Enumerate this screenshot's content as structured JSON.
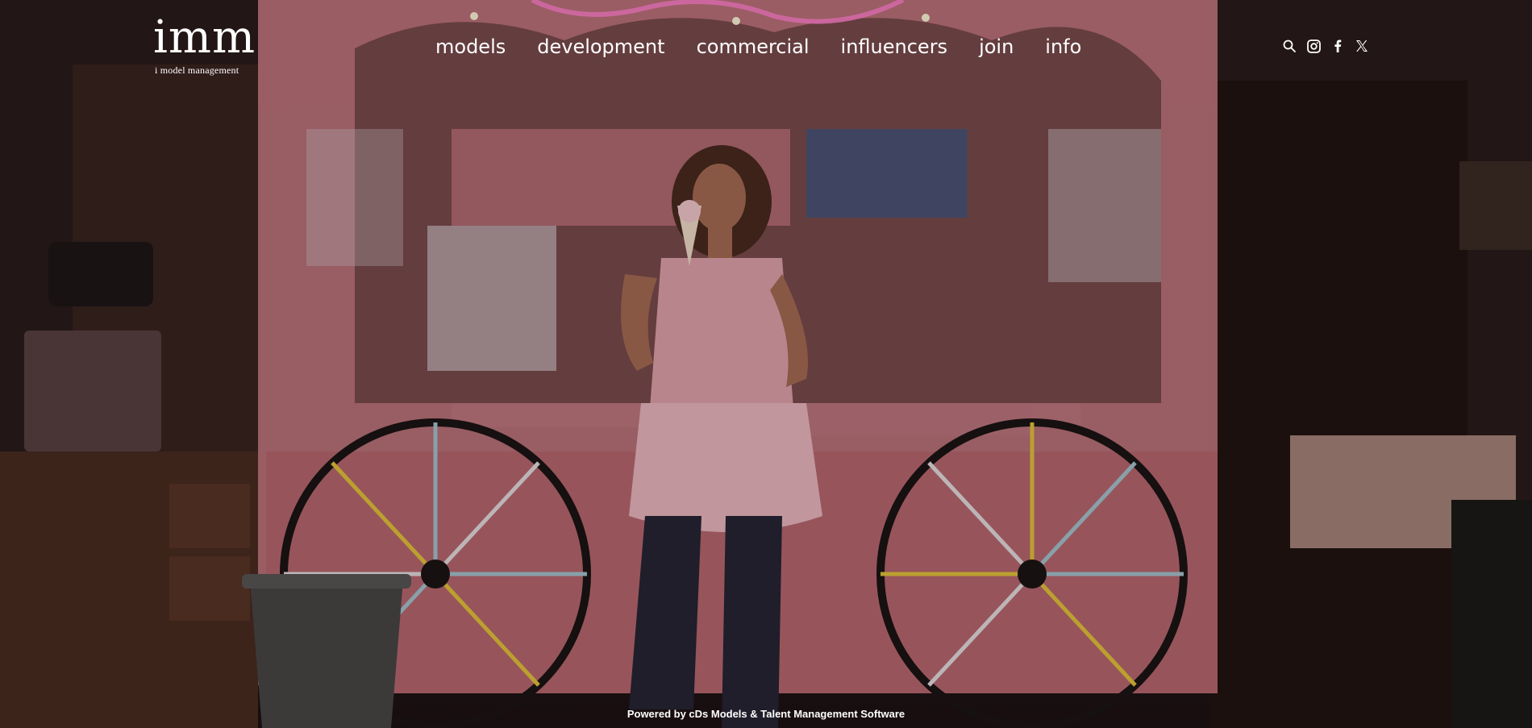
{
  "logo": {
    "mark": "imm",
    "subtitle": "i model management"
  },
  "nav": {
    "items": [
      {
        "label": "models"
      },
      {
        "label": "development"
      },
      {
        "label": "commercial"
      },
      {
        "label": "influencers"
      },
      {
        "label": "join"
      },
      {
        "label": "info"
      }
    ]
  },
  "social": {
    "icons": [
      "search-icon",
      "instagram-icon",
      "facebook-icon",
      "x-icon"
    ]
  },
  "footer": {
    "text": "Powered by cDs Models & Talent Management Software"
  },
  "colors": {
    "text": "#ffffff",
    "pink": "#d98a93",
    "dark": "#1a0f10"
  }
}
